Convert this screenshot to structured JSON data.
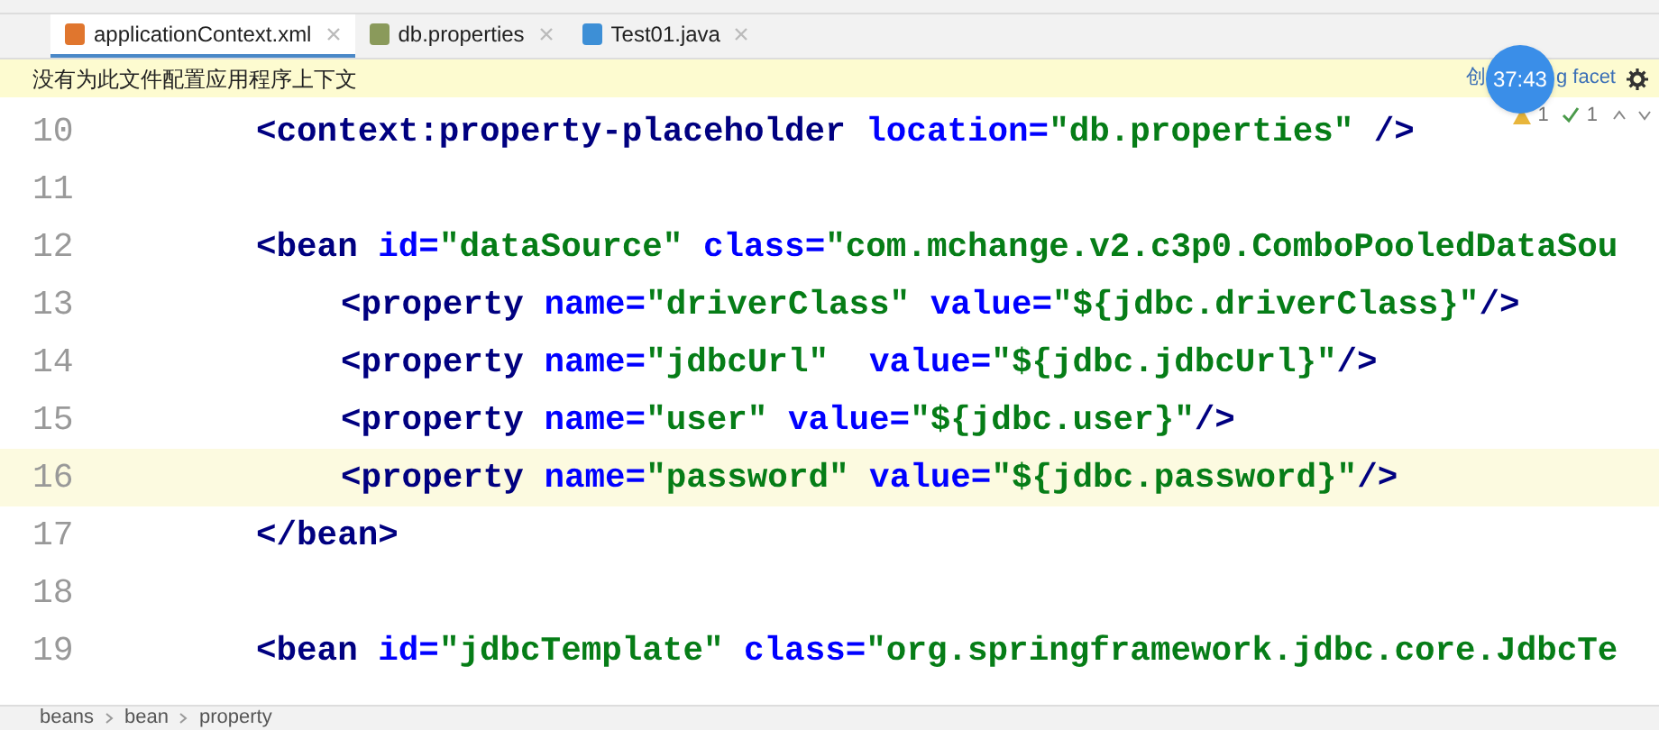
{
  "tabs": [
    {
      "label": "applicationContext.xml",
      "selected": true
    },
    {
      "label": "db.properties",
      "selected": false
    },
    {
      "label": "Test01.java",
      "selected": false
    }
  ],
  "banner": {
    "text": "没有为此文件配置应用程序上下文",
    "link_start": "创",
    "timer": "37:43",
    "link_end": "g facet"
  },
  "inspections": {
    "warnings": "1",
    "checks": "1"
  },
  "lines": [
    {
      "number": "10",
      "current": false,
      "tokens": [
        {
          "kind": "tag",
          "text": "<context:property-placeholder"
        },
        {
          "kind": "attr",
          "text": " location="
        },
        {
          "kind": "str",
          "text": "\"db.properties\""
        },
        {
          "kind": "tag",
          "text": " />"
        }
      ]
    },
    {
      "number": "11",
      "current": false
    },
    {
      "number": "12",
      "current": false,
      "tokens": [
        {
          "kind": "tag",
          "text": "<bean"
        },
        {
          "kind": "attr",
          "text": " id="
        },
        {
          "kind": "str",
          "text": "\"dataSource\""
        },
        {
          "kind": "attr",
          "text": " class="
        },
        {
          "kind": "str",
          "text": "\"com.mchange.v2.c3p0.ComboPooledDataSou"
        }
      ],
      "children": [
        {
          "number": "13",
          "current": false,
          "tokens": [
            {
              "kind": "tag",
              "text": "<property"
            },
            {
              "kind": "attr",
              "text": " name="
            },
            {
              "kind": "str",
              "text": "\"driverClass\""
            },
            {
              "kind": "attr",
              "text": " value="
            },
            {
              "kind": "str",
              "text": "\"${jdbc.driverClass}\""
            },
            {
              "kind": "tag",
              "text": "/>"
            }
          ]
        },
        {
          "number": "14",
          "current": false,
          "tokens": [
            {
              "kind": "tag",
              "text": "<property"
            },
            {
              "kind": "attr",
              "text": " name="
            },
            {
              "kind": "str",
              "text": "\"jdbcUrl\""
            },
            {
              "kind": "attr",
              "text": "  value="
            },
            {
              "kind": "str",
              "text": "\"${jdbc.jdbcUrl}\""
            },
            {
              "kind": "tag",
              "text": "/>"
            }
          ]
        },
        {
          "number": "15",
          "current": false,
          "tokens": [
            {
              "kind": "tag",
              "text": "<property"
            },
            {
              "kind": "attr",
              "text": " name="
            },
            {
              "kind": "str",
              "text": "\"user\""
            },
            {
              "kind": "attr",
              "text": " value="
            },
            {
              "kind": "str",
              "text": "\"${jdbc.user}\""
            },
            {
              "kind": "tag",
              "text": "/>"
            }
          ]
        },
        {
          "number": "16",
          "current": true,
          "tokens": [
            {
              "kind": "tag",
              "text": "<property"
            },
            {
              "kind": "attr",
              "text": " name="
            },
            {
              "kind": "str",
              "text": "\"password\""
            },
            {
              "kind": "attr",
              "text": " value="
            },
            {
              "kind": "str",
              "text": "\"${jdbc.password}\""
            },
            {
              "kind": "tag",
              "text": "/>"
            }
          ]
        }
      ]
    },
    {
      "number": "17",
      "current": false,
      "tokens": [
        {
          "kind": "tag",
          "text": "</bean>"
        }
      ]
    },
    {
      "number": "18",
      "current": false
    },
    {
      "number": "19",
      "current": false,
      "tokens": [
        {
          "kind": "tag",
          "text": "<bean"
        },
        {
          "kind": "attr",
          "text": " id="
        },
        {
          "kind": "str",
          "text": "\"jdbcTemplate\""
        },
        {
          "kind": "attr",
          "text": " class="
        },
        {
          "kind": "str",
          "text": "\"org.springframework.jdbc.core.JdbcTe"
        }
      ]
    }
  ],
  "breadcrumbs": [
    "beans",
    "bean",
    "property"
  ]
}
